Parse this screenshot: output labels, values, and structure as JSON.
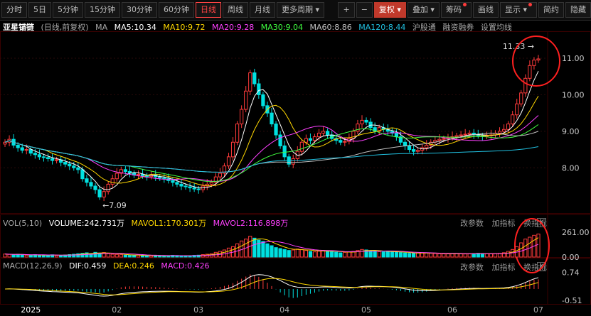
{
  "toolbar": {
    "periods": [
      "分时",
      "5日",
      "5分钟",
      "15分钟",
      "30分钟",
      "60分钟",
      "日线",
      "周线",
      "月线",
      "更多周期"
    ],
    "active": "日线",
    "tools": [
      "+",
      "−",
      "复权",
      "叠加",
      "筹码",
      "画线",
      "显示",
      "简约",
      "隐藏"
    ]
  },
  "legend": {
    "name": "亚星锚链",
    "mode": "(日线,前复权)",
    "ma_label": "MA",
    "ma5": "MA5:10.34",
    "ma10": "MA10:9.72",
    "ma20": "MA20:9.28",
    "ma30": "MA30:9.04",
    "ma60": "MA60:8.86",
    "ma120": "MA120:8.44",
    "links": [
      "沪股通",
      "融资融券",
      "设置均线"
    ]
  },
  "vol_legend": {
    "label": "VOL(5,10)",
    "volume": "VOLUME:242.731万",
    "mavol1": "MAVOL1:170.301万",
    "mavol2": "MAVOL2:116.898万"
  },
  "macd_legend": {
    "label": "MACD(12,26,9)",
    "dif": "DIF:0.459",
    "dea": "DEA:0.246",
    "macd": "MACD:0.426"
  },
  "panel_buttons": [
    "改参数",
    "加指标",
    "换指标"
  ],
  "colors": {
    "up": "#ff3b3b",
    "down": "#00e0e0",
    "ma5": "#ffffff",
    "ma10": "#ffd700",
    "ma20": "#ff40ff",
    "ma30": "#40ff40",
    "ma60": "#c0c0c0",
    "ma120": "#20c0e0",
    "annot": "#ff2020"
  },
  "chart_data": {
    "type": "candlestick",
    "price_axis": {
      "ticks": [
        8.0,
        9.0,
        10.0,
        11.0
      ],
      "ylim": [
        6.8,
        11.7
      ]
    },
    "vol_axis": {
      "ticks": [
        "261.00",
        "0.00"
      ],
      "ylim": [
        0,
        300
      ]
    },
    "macd_axis": {
      "ticks": [
        "0.74",
        "-0.51"
      ],
      "ylim": [
        -0.6,
        0.85
      ]
    },
    "x_labels": [
      "2025",
      "02",
      "03",
      "04",
      "05",
      "06",
      "07"
    ],
    "label_positions": [
      6,
      26,
      45,
      65,
      84,
      104,
      124
    ],
    "n_days": 125,
    "annotations": {
      "high": "11.33",
      "low": "7.09",
      "low_index": 22,
      "high_index": 123
    },
    "close": [
      8.7,
      8.78,
      8.62,
      8.55,
      8.48,
      8.5,
      8.4,
      8.36,
      8.3,
      8.28,
      8.25,
      8.2,
      8.22,
      8.15,
      8.1,
      8.05,
      8.0,
      7.95,
      7.7,
      7.6,
      7.5,
      7.4,
      7.2,
      7.35,
      7.55,
      7.7,
      7.85,
      7.95,
      7.9,
      7.85,
      7.8,
      7.82,
      7.78,
      7.76,
      7.8,
      7.75,
      7.72,
      7.7,
      7.65,
      7.6,
      7.55,
      7.5,
      7.48,
      7.45,
      7.42,
      7.4,
      7.5,
      7.55,
      7.6,
      7.75,
      7.85,
      8.05,
      8.3,
      8.7,
      9.2,
      9.6,
      10.1,
      10.6,
      10.3,
      10.0,
      9.7,
      9.5,
      9.2,
      8.9,
      8.6,
      8.3,
      8.1,
      8.25,
      8.45,
      8.7,
      8.8,
      8.75,
      8.85,
      8.95,
      9.0,
      8.9,
      8.8,
      8.75,
      8.7,
      8.72,
      8.8,
      9.0,
      9.2,
      9.3,
      9.25,
      9.1,
      9.0,
      9.1,
      9.05,
      9.0,
      8.95,
      8.85,
      8.7,
      8.6,
      8.5,
      8.45,
      8.48,
      8.55,
      8.62,
      8.7,
      8.75,
      8.78,
      8.8,
      8.82,
      8.85,
      8.88,
      8.9,
      8.92,
      8.95,
      8.9,
      8.88,
      8.86,
      8.88,
      8.9,
      8.95,
      9.0,
      9.05,
      9.2,
      9.45,
      9.75,
      10.05,
      10.45,
      10.8,
      10.95,
      10.98
    ],
    "volume": [
      32,
      28,
      25,
      30,
      22,
      20,
      18,
      25,
      22,
      18,
      20,
      24,
      16,
      18,
      22,
      26,
      30,
      35,
      40,
      45,
      38,
      50,
      42,
      48,
      36,
      30,
      28,
      25,
      20,
      18,
      16,
      22,
      18,
      15,
      14,
      16,
      15,
      12,
      14,
      18,
      16,
      14,
      12,
      15,
      18,
      20,
      26,
      30,
      35,
      50,
      60,
      75,
      95,
      110,
      140,
      170,
      190,
      220,
      200,
      180,
      165,
      140,
      120,
      100,
      90,
      80,
      70,
      75,
      85,
      80,
      70,
      60,
      55,
      62,
      70,
      64,
      58,
      52,
      45,
      50,
      56,
      60,
      70,
      80,
      75,
      68,
      62,
      58,
      55,
      60,
      58,
      52,
      48,
      44,
      40,
      38,
      42,
      46,
      44,
      40,
      38,
      36,
      35,
      34,
      36,
      38,
      35,
      33,
      34,
      36,
      40,
      38,
      36,
      34,
      38,
      40,
      46,
      60,
      80,
      110,
      150,
      190,
      210,
      230,
      243
    ]
  }
}
